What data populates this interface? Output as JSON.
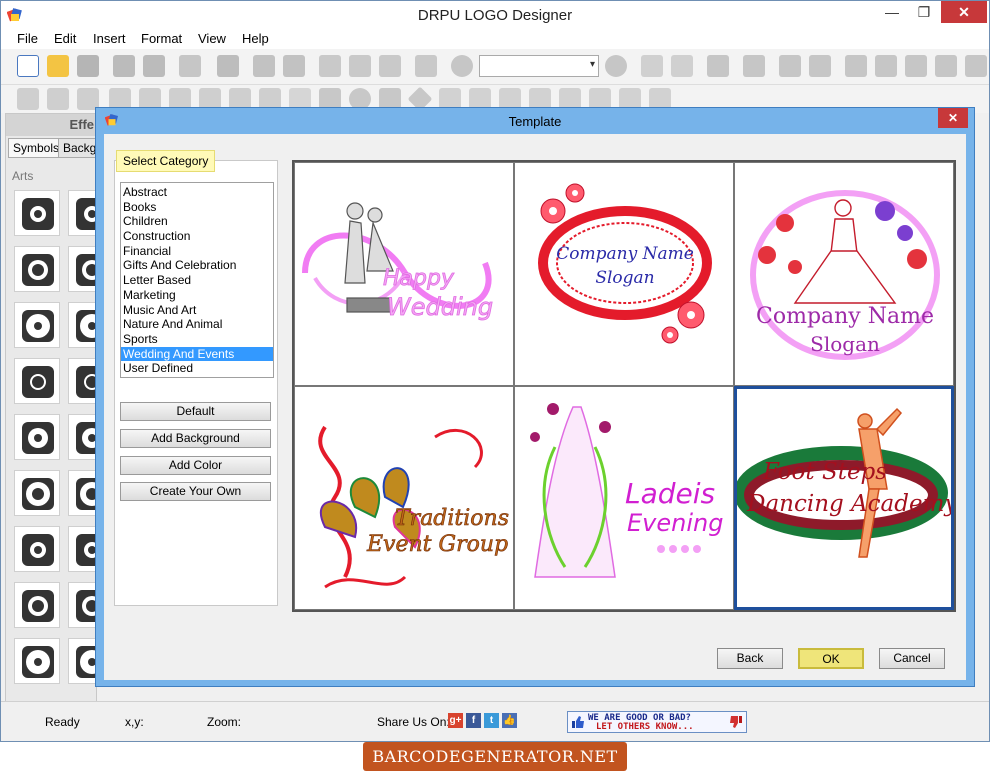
{
  "window": {
    "title": "DRPU LOGO Designer",
    "min": "—",
    "max": "❐",
    "close": "✕"
  },
  "menu": [
    "File",
    "Edit",
    "Insert",
    "Format",
    "View",
    "Help"
  ],
  "left_panel": {
    "header": "Effe",
    "tabs": [
      "Symbols",
      "Backgr"
    ],
    "section": "Arts"
  },
  "status": {
    "ready": "Ready",
    "xy": "x,y:",
    "zoom": "Zoom:",
    "share": "Share Us On:",
    "share_icons": [
      "g+",
      "f",
      "t",
      "👍"
    ]
  },
  "feedback": {
    "line1": "WE ARE GOOD OR BAD?",
    "line2": "LET OTHERS KNOW..."
  },
  "watermark": "BARCODEGENERATOR.NET",
  "dialog": {
    "title": "Template",
    "close": "✕",
    "category_label": "Select Category",
    "categories": [
      "Abstract",
      "Books",
      "Children",
      "Construction",
      "Financial",
      "Gifts And Celebration",
      "Letter Based",
      "Marketing",
      "Music And Art",
      "Nature And Animal",
      "Sports",
      "Wedding And Events",
      "User Defined"
    ],
    "selected_category": "Wedding And Events",
    "side_buttons": [
      "Default",
      "Add Background",
      "Add Color",
      "Create Your Own"
    ],
    "templates": [
      {
        "line1": "Happy",
        "line2": "Wedding"
      },
      {
        "line1": "Company Name",
        "line2": "Slogan"
      },
      {
        "line1": "Company Name",
        "line2": "Slogan"
      },
      {
        "line1": "Traditions",
        "line2": "Event Group"
      },
      {
        "line1": "Ladeis",
        "line2": "Evening"
      },
      {
        "line1": "Foot Steps",
        "line2": "Dancing Academy"
      }
    ],
    "selected_template": 5,
    "footer": {
      "back": "Back",
      "ok": "OK",
      "cancel": "Cancel"
    }
  },
  "colors": {
    "dialog_frame": "#76b3ea",
    "selection": "#3399ff",
    "ok_highlight": "#efe57a",
    "close_red": "#c7383a"
  }
}
